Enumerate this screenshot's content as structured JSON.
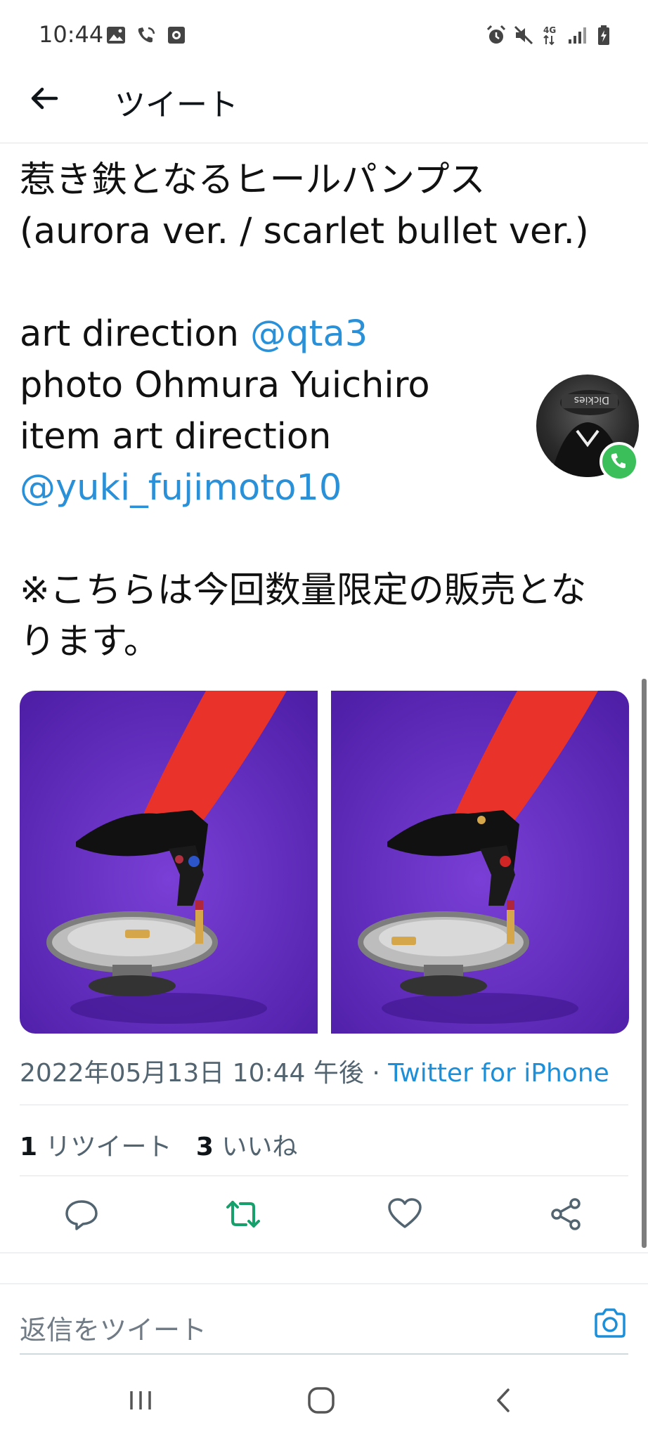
{
  "status_bar": {
    "time": "10:44"
  },
  "header": {
    "title": "ツイート"
  },
  "tweet": {
    "lines": [
      [
        {
          "text": "惹き鉄となるヒールパンプス"
        }
      ],
      [
        {
          "text": "(aurora ver. / scarlet bullet ver.)"
        }
      ],
      [
        {
          "text": ""
        }
      ],
      [
        {
          "text": "art direction "
        },
        {
          "text": "@qta3",
          "mention": true
        }
      ],
      [
        {
          "text": "photo Ohmura Yuichiro"
        }
      ],
      [
        {
          "text": "item art direction"
        }
      ],
      [
        {
          "text": "@yuki_fujimoto10",
          "mention": true
        }
      ],
      [
        {
          "text": ""
        }
      ],
      [
        {
          "text": "※こちらは今回数量限定の販売とな"
        }
      ],
      [
        {
          "text": "ります。"
        }
      ]
    ]
  },
  "meta": {
    "datetime": "2022年05月13日 10:44 午後",
    "separator": " · ",
    "source": "Twitter for iPhone"
  },
  "stats": {
    "retweet_count": "1",
    "retweet_label": "リツイート",
    "like_count": "3",
    "like_label": "いいね"
  },
  "reply": {
    "placeholder": "返信をツイート"
  },
  "colors": {
    "mention": "#2a90d8",
    "retweet_active": "#17a06b",
    "photo_bg": "#6a2fc0",
    "tights": "#e8322a"
  },
  "icons": [
    "back-arrow-icon",
    "reply-icon",
    "retweet-icon",
    "like-icon",
    "share-icon",
    "camera-icon",
    "recent-apps-icon",
    "home-icon",
    "back-icon"
  ]
}
